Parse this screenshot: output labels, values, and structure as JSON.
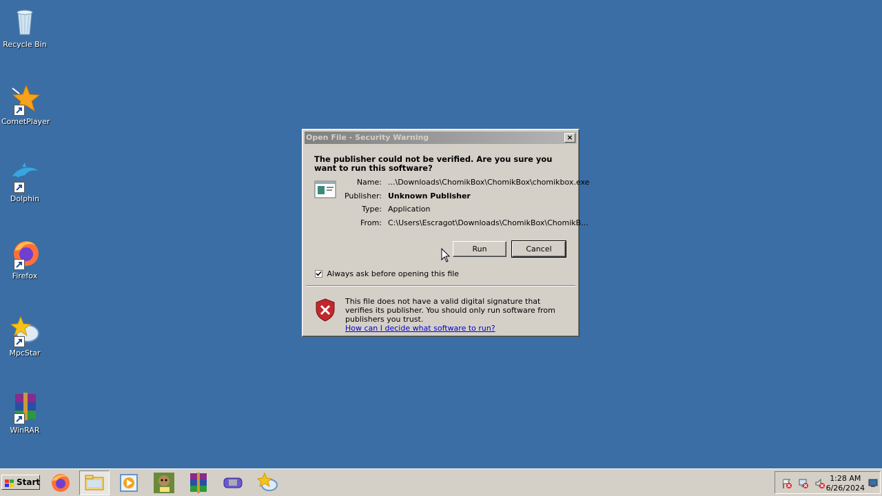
{
  "desktop": {
    "icons": [
      {
        "label": "Recycle Bin"
      },
      {
        "label": "CometPlayer"
      },
      {
        "label": "Dolphin"
      },
      {
        "label": "Firefox"
      },
      {
        "label": "MpcStar"
      },
      {
        "label": "WinRAR"
      }
    ]
  },
  "dialog": {
    "title": "Open File - Security Warning",
    "close_label": "×",
    "heading": "The publisher could not be verified.  Are you sure you want to run this software?",
    "fields": {
      "name_key": "Name:",
      "name_value": "...\\Downloads\\ChomikBox\\ChomikBox\\chomikbox.exe",
      "publisher_key": "Publisher:",
      "publisher_value": "Unknown Publisher",
      "type_key": "Type:",
      "type_value": "Application",
      "from_key": "From:",
      "from_value": "C:\\Users\\Escragot\\Downloads\\ChomikBox\\ChomikB..."
    },
    "run_label": "Run",
    "cancel_label": "Cancel",
    "checkbox_label": "Always ask before opening this file",
    "checkbox_checked": true,
    "warning_text": "This file does not have a valid digital signature that verifies its publisher.  You should only run software from publishers you trust.",
    "warning_link": "How can I decide what software to run?"
  },
  "taskbar": {
    "start_label": "Start",
    "clock_time": "1:28 AM",
    "clock_date": "6/26/2024"
  }
}
